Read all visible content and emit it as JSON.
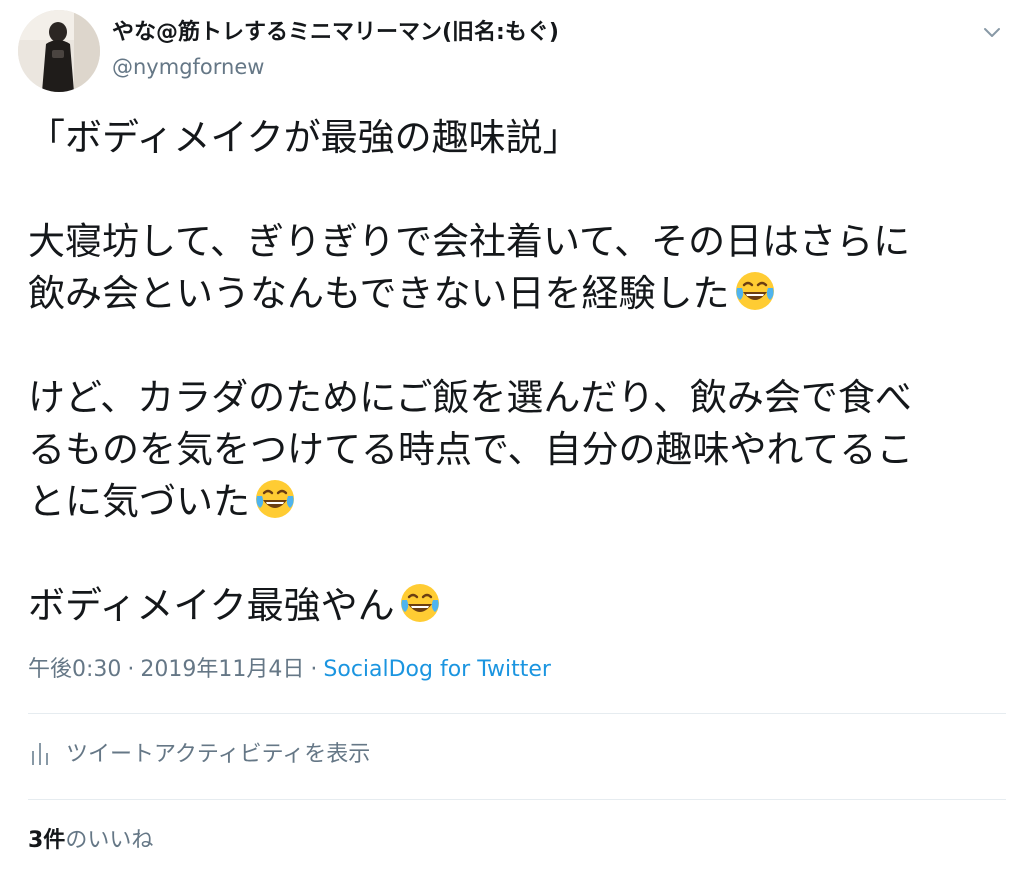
{
  "user": {
    "display_name": "やな@筋トレするミニマリーマン(旧名:もぐ)",
    "handle": "@nymgfornew"
  },
  "tweet": {
    "paragraphs": [
      [
        "「ボディメイクが最強の趣味説」"
      ],
      [
        "大寝坊して、ぎりぎりで会社着いて、その日はさらに",
        "飲み会というなんもできない日を経験した"
      ],
      [
        "けど、カラダのためにご飯を選んだり、飲み会で食べ",
        "るものを気をつけてる時点で、自分の趣味やれてるこ",
        "とに気づいた"
      ],
      [
        "ボディメイク最強やん"
      ]
    ],
    "emoji": "face-with-tears-of-joy"
  },
  "meta": {
    "time": "午後0:30",
    "separator": "·",
    "date": "2019年11月4日",
    "source": "SocialDog for Twitter"
  },
  "activity": {
    "label": "ツイートアクティビティを表示",
    "icon": "bar-chart-icon"
  },
  "likes": {
    "count": "3件",
    "label": "のいいね"
  },
  "colors": {
    "text": "#14171a",
    "secondary": "#657786",
    "link": "#1b95e0",
    "divider": "#e6ecf0"
  }
}
